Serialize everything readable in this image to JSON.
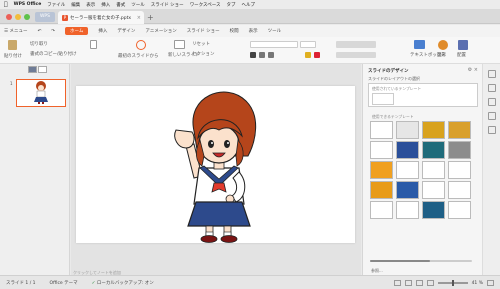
{
  "menubar": {
    "apple": "",
    "app_name": "WPS Office",
    "items": [
      "ファイル",
      "編集",
      "表示",
      "挿入",
      "書式",
      "ツール",
      "スライド ショー",
      "ワークスペース",
      "タブ",
      "ヘルプ"
    ]
  },
  "window": {
    "tab_wps": "WPS",
    "doc_tab": "セーラー服を着た女の子.pptx",
    "add_tab": "+"
  },
  "ribbon": {
    "menu_label": "メニュー",
    "tabs": [
      "ホーム",
      "挿入",
      "デザイン",
      "アニメーション",
      "スライド ショー",
      "校閲",
      "表示",
      "ツール"
    ],
    "active_tab": "ホーム",
    "paste": "貼り付け",
    "cut": "切り取り",
    "format_copy": "書式のコピー/貼り付け",
    "from_start": "最初のスライドから",
    "new_slide": "新しいスライド",
    "reset": "リセット",
    "section": "セクション",
    "textbox": "テキストボックス",
    "shapes": "図形",
    "arrange": "配置"
  },
  "left_panel": {
    "slide_number": "1"
  },
  "notes_placeholder": "クリックしてノートを追加",
  "right_panel": {
    "title": "スライドのデザイン",
    "subtitle": "スライドのレイアウトの選択",
    "used_label": "使用されているテンプレート",
    "available_label": "使用できるテンプレート",
    "footer": "参照..."
  },
  "status": {
    "slide_info": "スライド 1 / 1",
    "theme": "Office テーマ",
    "backup": "ローカルバックアップ: オン",
    "zoom": "41 %"
  },
  "colors": {
    "accent": "#f0622a",
    "template_thumbs": [
      "#ffffff",
      "#e6e6e6",
      "#d8a21e",
      "#d9a02c",
      "#ffffff",
      "#2a4f9a",
      "#1f6b7a",
      "#8c8c8c",
      "#f0a020",
      "#ffffff",
      "#ffffff",
      "#ffffff",
      "#e89b18",
      "#2a5aa8",
      "#ffffff",
      "#ffffff",
      "#ffffff",
      "#ffffff",
      "#1e5f86",
      "#ffffff"
    ]
  }
}
